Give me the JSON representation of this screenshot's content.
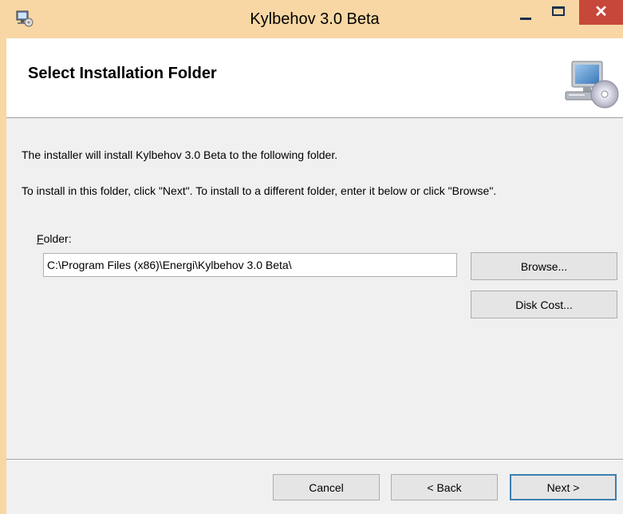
{
  "window": {
    "title": "Kylbehov 3.0 Beta",
    "controls": {
      "minimize": "—",
      "maximize": "☐",
      "close": "✕"
    },
    "frame_color": "#f8d7a4",
    "close_color": "#c7473a"
  },
  "header": {
    "title": "Select Installation Folder",
    "icon": "computer-cd-icon"
  },
  "body": {
    "line1": "The installer will install Kylbehov 3.0 Beta to the following folder.",
    "line2": "To install in this folder, click \"Next\". To install to a different folder, enter it below or click \"Browse\".",
    "folder_label_hotkey": "F",
    "folder_label_rest": "older:",
    "folder_value": "C:\\Program Files (x86)\\Energi\\Kylbehov 3.0 Beta\\",
    "browse_label": "Browse...",
    "disk_cost_label": "Disk Cost..."
  },
  "footer": {
    "cancel_label": "Cancel",
    "back_label": "< Back",
    "next_label": "Next >",
    "default_button_color": "#3c7fb1"
  }
}
